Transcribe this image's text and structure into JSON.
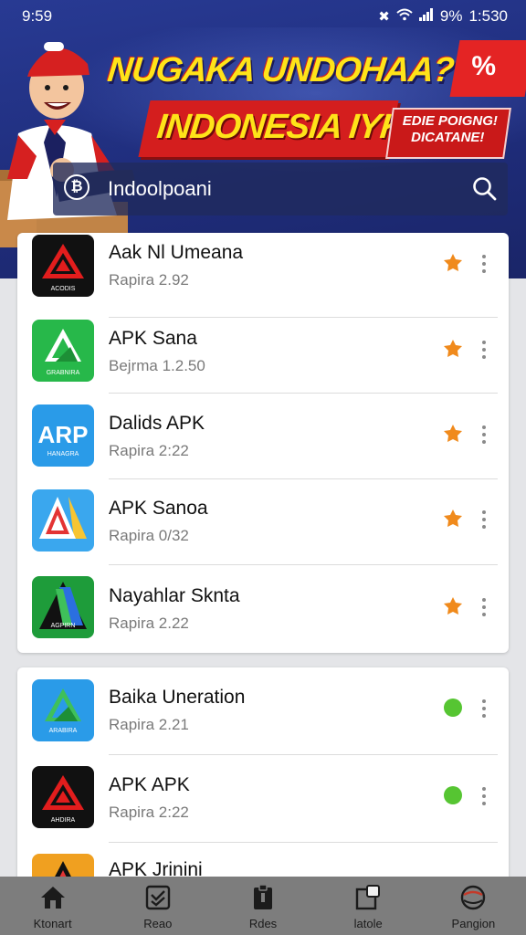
{
  "status_bar": {
    "time": "9:59",
    "battery": "9%",
    "clock_right": "1:530"
  },
  "banner": {
    "headline": "NUGAKA UNDOHAA?",
    "subhead": "INDONESIA IYK",
    "corner_symbol": "%",
    "promo_line1": "EDIE POIGNG!",
    "promo_line2": "DICATANE!"
  },
  "search": {
    "value": "Indoolpoani",
    "icon": "bitcoin-icon",
    "action_icon": "search-icon"
  },
  "apps_primary": [
    {
      "name": "Aak Nl Umeana",
      "version": "Rapira 2.92",
      "icon_style": "red-triangle-black",
      "badge_color": "#f08a1c"
    },
    {
      "name": "APK Sana",
      "version": "Bejrma 1.2.50",
      "icon_style": "green-a",
      "badge_color": "#f08a1c"
    },
    {
      "name": "Dalids APK",
      "version": "Rapira 2:22",
      "icon_style": "blue-arp",
      "badge_color": "#f08a1c"
    },
    {
      "name": "APK Sanoa",
      "version": "Rapira 0/32",
      "icon_style": "blue-red-a",
      "badge_color": "#f08a1c"
    },
    {
      "name": "Nayahlar Sknta",
      "version": "Rapira 2.22",
      "icon_style": "green-dark-a",
      "badge_color": "#f08a1c"
    }
  ],
  "apps_secondary": [
    {
      "name": "Baika Uneration",
      "version": "Rapira 2.21",
      "icon_style": "blue-green-a",
      "badge_color": "#56c532"
    },
    {
      "name": "APK APK",
      "version": "Rapira 2:22",
      "icon_style": "red-triangle-black",
      "badge_color": "#56c532"
    },
    {
      "name": "APK Jrinini",
      "version": "",
      "icon_style": "orange",
      "badge_color": "#56c532"
    }
  ],
  "icon_labels": {
    "app1": "ACODIS",
    "app2": "GRABNIRA",
    "app3": "HANAGRA",
    "app5": "AGPIRN",
    "app6": "ARABIRA",
    "app7": "AHDIRA"
  },
  "bottom_nav": [
    {
      "label": "Ktonart",
      "icon": "home-icon"
    },
    {
      "label": "Reao",
      "icon": "checklist-icon"
    },
    {
      "label": "Rdes",
      "icon": "clipboard-icon"
    },
    {
      "label": "latole",
      "icon": "window-icon"
    },
    {
      "label": "Pangion",
      "icon": "globe-icon"
    }
  ]
}
